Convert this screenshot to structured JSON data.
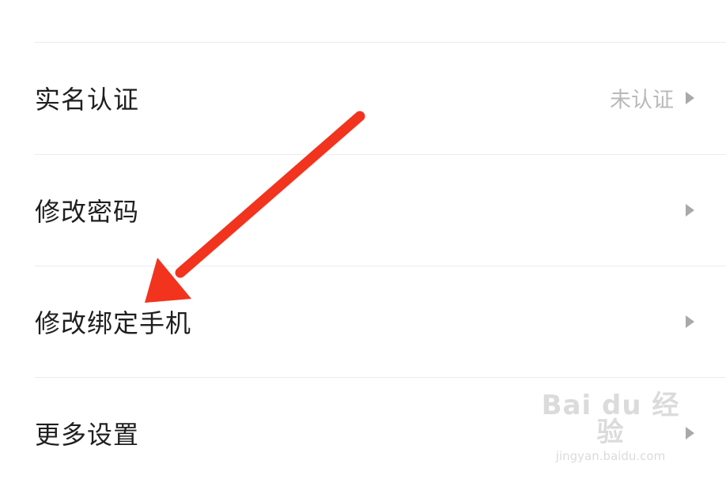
{
  "settings": {
    "items": [
      {
        "label": "实名认证",
        "value": "未认证"
      },
      {
        "label": "修改密码",
        "value": ""
      },
      {
        "label": "修改绑定手机",
        "value": ""
      },
      {
        "label": "更多设置",
        "value": ""
      }
    ]
  },
  "icons": {
    "chevron": "chevron-right-icon",
    "annotation": "red-arrow"
  },
  "colors": {
    "annotation_arrow": "#f2331e",
    "label_text": "#1f1f1f",
    "value_text": "#b9b9b9",
    "divider": "#ececec"
  },
  "watermark": {
    "brand": "Bai du 经验",
    "url": "jingyan.baidu.com"
  }
}
